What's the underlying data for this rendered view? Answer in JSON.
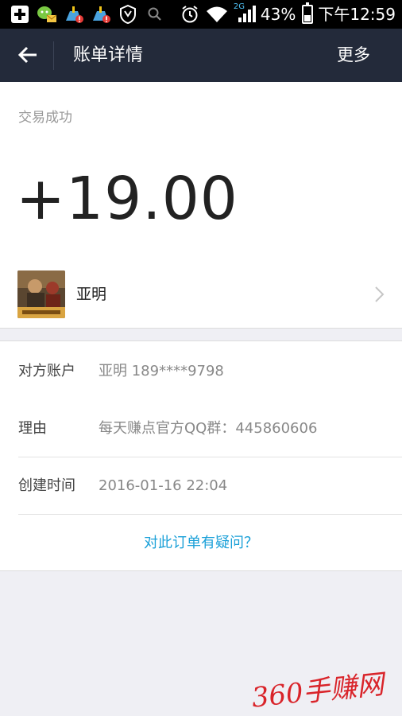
{
  "status_bar": {
    "battery": "43%",
    "battery_level": 0.43,
    "time": "下午12:59",
    "network": "2G",
    "icons": [
      "add-icon",
      "chat-mail-icon",
      "cleaner-alert-icon",
      "cleaner-alert-icon",
      "shield-icon",
      "search-icon",
      "alarm-icon",
      "wifi-icon",
      "signal-icon",
      "battery-icon"
    ]
  },
  "titlebar": {
    "title": "账单详情",
    "more": "更多"
  },
  "transaction": {
    "status": "交易成功",
    "amount": "+19.00",
    "merchant_name": "亚明"
  },
  "details": {
    "rows": [
      {
        "label": "对方账户",
        "value": "亚明 189****9798"
      },
      {
        "label": "理由",
        "value": "每天赚点官方QQ群：445860606"
      },
      {
        "label": "创建时间",
        "value": "2016-01-16 22:04"
      }
    ],
    "question_link": "对此订单有疑问？"
  },
  "watermark": "360手赚网",
  "colors": {
    "titlebar": "#232a3a",
    "link": "#1aa0d8",
    "watermark": "#d9242a"
  }
}
